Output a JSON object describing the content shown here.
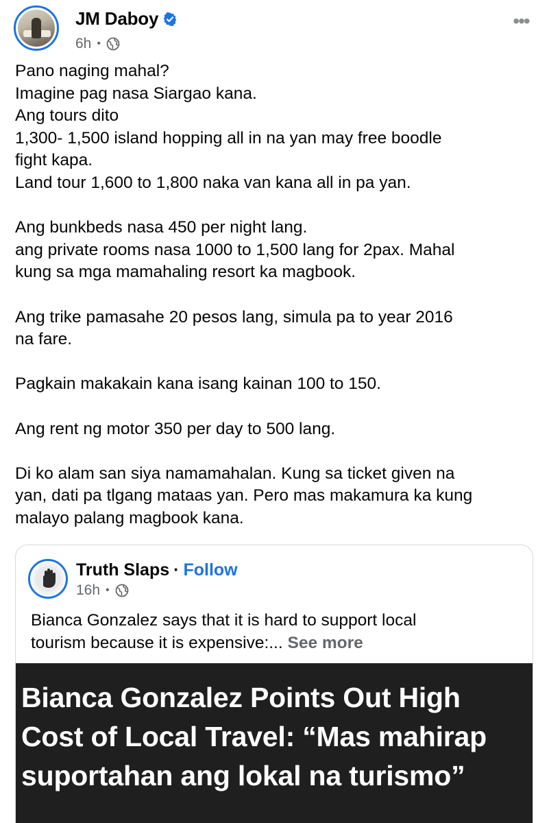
{
  "post": {
    "author": "JM Daboy",
    "time": "6h",
    "verified": true,
    "icons": {
      "verified": "verified-badge-icon",
      "audience": "globe-icon",
      "menu": "more-options-icon"
    },
    "lines": [
      "Pano naging mahal?",
      "Imagine pag nasa Siargao kana.",
      "Ang tours dito",
      "1,300- 1,500 island hopping all in na yan may free boodle",
      "fight kapa.",
      "Land tour 1,600 to 1,800 naka van kana all in pa yan.",
      "",
      "Ang bunkbeds nasa 450 per night lang.",
      "ang private rooms nasa 1000 to 1,500 lang for 2pax. Mahal",
      "kung sa mga mamahaling resort ka magbook.",
      "",
      "Ang trike pamasahe 20 pesos lang, simula pa to year 2016",
      "na fare.",
      "",
      "Pagkain makakain kana isang kainan 100 to 150.",
      "",
      "Ang rent ng motor 350 per day to 500 lang.",
      "",
      "Di ko alam san siya namamahalan. Kung sa ticket given na",
      "yan, dati pa tlgang mataas yan. Pero mas makamura ka kung",
      "malayo palang magbook kana."
    ]
  },
  "shared": {
    "author": "Truth Slaps",
    "separator": "·",
    "follow": "Follow",
    "time": "16h",
    "text_line1": "Bianca Gonzalez says that it is hard to support local",
    "text_line2": "tourism because it is expensive:...",
    "see_more": "See more",
    "headline": [
      "Bianca Gonzalez Points Out High",
      "Cost of Local Travel:  “Mas mahirap",
      "suportahan ang lokal na turismo”"
    ]
  },
  "colors": {
    "accent": "#1b74e4",
    "meta": "#65676b",
    "text": "#050505",
    "image_bg": "#1f1f1f"
  }
}
